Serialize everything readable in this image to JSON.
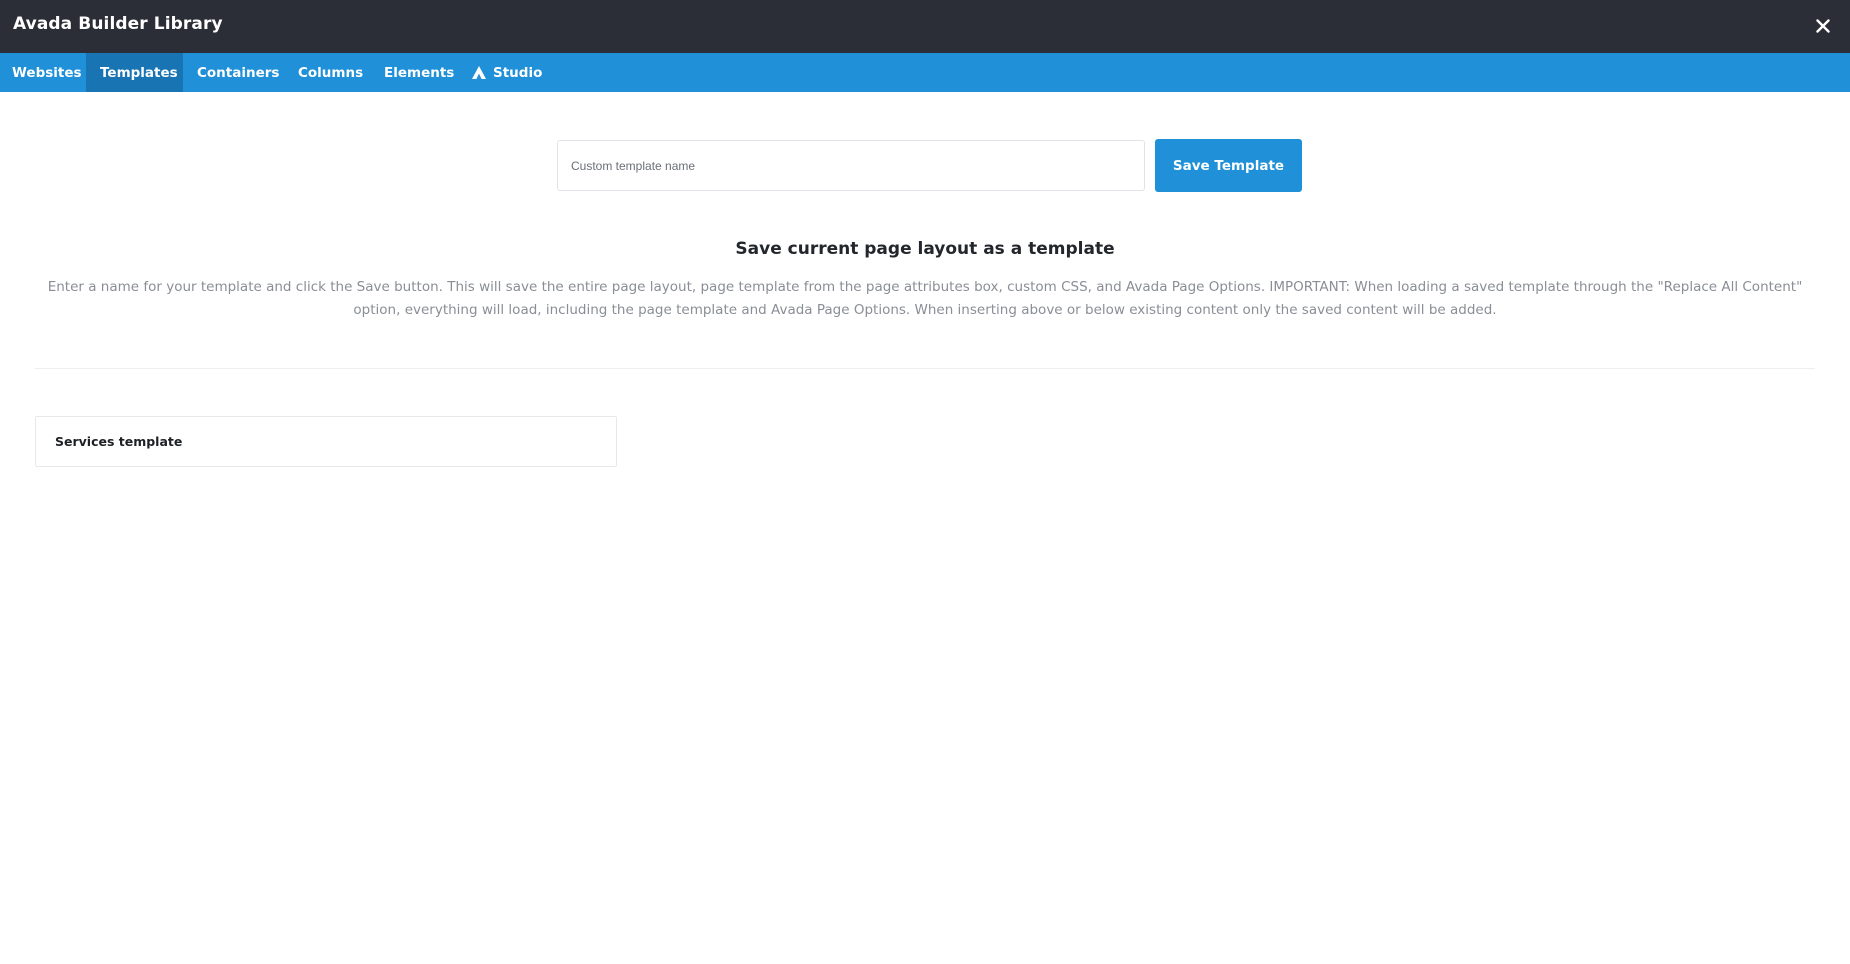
{
  "window": {
    "title": "Avada Builder Library",
    "close_icon": "close-icon"
  },
  "tabs": [
    {
      "label": "Websites",
      "active": false
    },
    {
      "label": "Templates",
      "active": true
    },
    {
      "label": "Containers",
      "active": false
    },
    {
      "label": "Columns",
      "active": false
    },
    {
      "label": "Elements",
      "active": false
    },
    {
      "label": "Studio",
      "active": false,
      "icon": "avada-studio-icon"
    }
  ],
  "save_form": {
    "placeholder": "Custom template name",
    "value": "",
    "button_label": "Save Template"
  },
  "info": {
    "heading": "Save current page layout as a template",
    "description": "Enter a name for your template and click the Save button. This will save the entire page layout, page template from the page attributes box, custom CSS, and Avada Page Options. IMPORTANT: When loading a saved template through the \"Replace All Content\" option, everything will load, including the page template and Avada Page Options. When inserting above or below existing content only the saved content will be added."
  },
  "templates": [
    {
      "name": "Services template"
    }
  ],
  "colors": {
    "titlebar": "#2b2e36",
    "tabbar": "#2090d8",
    "tab_active": "#1874b3",
    "button": "#2090d8"
  }
}
